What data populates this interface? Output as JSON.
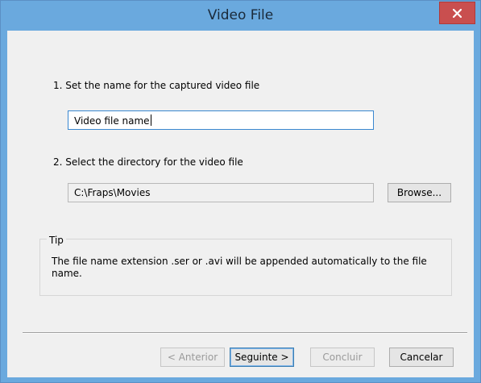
{
  "window": {
    "title": "Video File"
  },
  "step1": {
    "label": "1. Set the name for the captured video file",
    "value": "Video file name"
  },
  "step2": {
    "label": "2. Select the directory for the video file",
    "value": "C:\\Fraps\\Movies",
    "browse_label": "Browse..."
  },
  "tip": {
    "title": "Tip",
    "text": "The file name extension .ser or .avi will be appended automatically to the file name."
  },
  "footer": {
    "back_label": "< Anterior",
    "next_label": "Seguinte >",
    "finish_label": "Concluir",
    "cancel_label": "Cancelar"
  },
  "icons": {
    "close": "close-icon"
  },
  "colors": {
    "titlebar": "#6aa9de",
    "close_button": "#c94f4f",
    "dialog_background": "#f0f0f0",
    "focus_border": "#3a87d0"
  }
}
